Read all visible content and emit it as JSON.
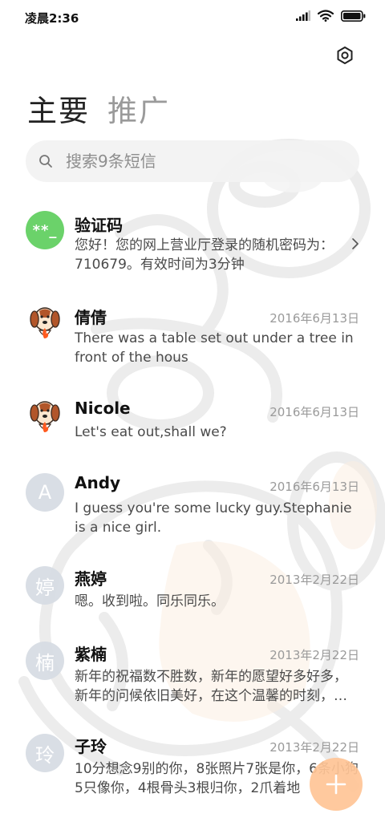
{
  "status_bar": {
    "time": "凌晨2:36"
  },
  "tabs": [
    {
      "label": "主要",
      "active": true
    },
    {
      "label": "推广",
      "active": false
    }
  ],
  "search": {
    "placeholder": "搜索9条短信"
  },
  "conversations": [
    {
      "name": "验证码",
      "avatar_text": "**_",
      "avatar_type": "green",
      "date": "",
      "preview": "您好！您的网上营业厅登录的随机密码为：710679。有效时间为3分钟",
      "has_chevron": true
    },
    {
      "name": "倩倩",
      "avatar_type": "dog",
      "date": "2016年6月13日",
      "preview": "There was a table set out under a tree in front of the hous"
    },
    {
      "name": "Nicole",
      "avatar_type": "dog",
      "date": "2016年6月13日",
      "preview": "Let's eat out,shall we?"
    },
    {
      "name": "Andy",
      "avatar_text": "A",
      "avatar_type": "letter",
      "date": "2016年6月13日",
      "preview": "I guess you're some lucky guy.Stephanie is a nice girl."
    },
    {
      "name": "燕婷",
      "avatar_text": "婷",
      "avatar_type": "letter",
      "date": "2013年2月22日",
      "preview": "嗯。收到啦。同乐同乐。"
    },
    {
      "name": "紫楠",
      "avatar_text": "楠",
      "avatar_type": "letter",
      "date": "2013年2月22日",
      "preview": "新年的祝福数不胜数，新年的愿望好多好多，新年的问候依旧美好，在这个温馨的时刻，…"
    },
    {
      "name": "子玲",
      "avatar_text": "玲",
      "avatar_type": "letter",
      "date": "2013年2月22日",
      "preview": "10分想念9别的你，8张照片7张是你，6条小狗5只像你，4根骨头3根归你，2爪着地"
    }
  ],
  "colors": {
    "accent_fab": "#ffc496",
    "verification_avatar": "#6bd26a",
    "letter_avatar": "#d7dce4"
  },
  "icons": {
    "settings": "settings-hexagon-icon",
    "search": "search-icon",
    "chevron": "chevron-right-icon",
    "fab": "plus-icon"
  }
}
